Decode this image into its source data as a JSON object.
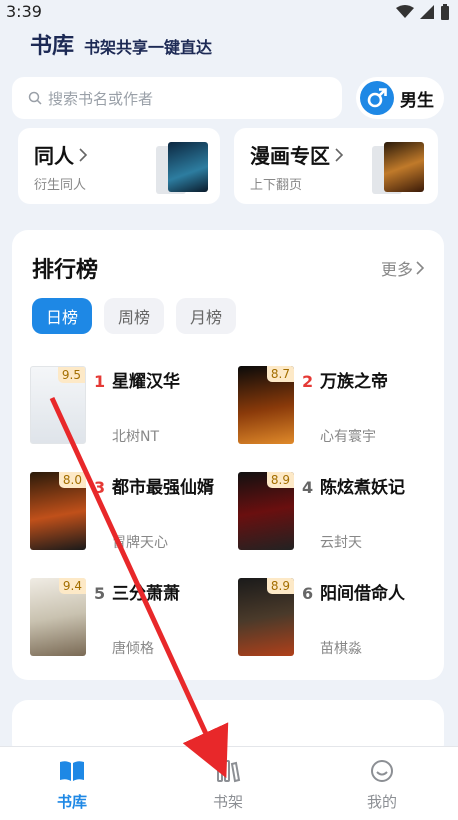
{
  "status": {
    "time": "3:39"
  },
  "header": {
    "brand": "书库",
    "slogan": "书架共享一键直达"
  },
  "search": {
    "placeholder": "搜索书名或作者"
  },
  "gender": {
    "label": "男生"
  },
  "categories": [
    {
      "title": "同人",
      "subtitle": "衍生同人"
    },
    {
      "title": "漫画专区",
      "subtitle": "上下翻页"
    }
  ],
  "ranking": {
    "title": "排行榜",
    "more": "更多",
    "tabs": [
      "日榜",
      "周榜",
      "月榜"
    ],
    "books": [
      {
        "rank": "1",
        "title": "星耀汉华",
        "author": "北树NT",
        "score": "9.5"
      },
      {
        "rank": "2",
        "title": "万族之帝",
        "author": "心有寰宇",
        "score": "8.7"
      },
      {
        "rank": "3",
        "title": "都市最强仙婿",
        "author": "冒牌天心",
        "score": "8.0"
      },
      {
        "rank": "4",
        "title": "陈炫煮妖记",
        "author": "云封天",
        "score": "8.9"
      },
      {
        "rank": "5",
        "title": "三分萧萧",
        "author": "唐倾格",
        "score": "9.4"
      },
      {
        "rank": "6",
        "title": "阳间借命人",
        "author": "苗棋淼",
        "score": "8.9"
      }
    ]
  },
  "nav": {
    "items": [
      "书库",
      "书架",
      "我的"
    ]
  },
  "colors": {
    "accent": "#1e88e5",
    "rank_top": "#e53935",
    "rank_other": "#666666",
    "annotation_arrow": "#e8282a"
  }
}
